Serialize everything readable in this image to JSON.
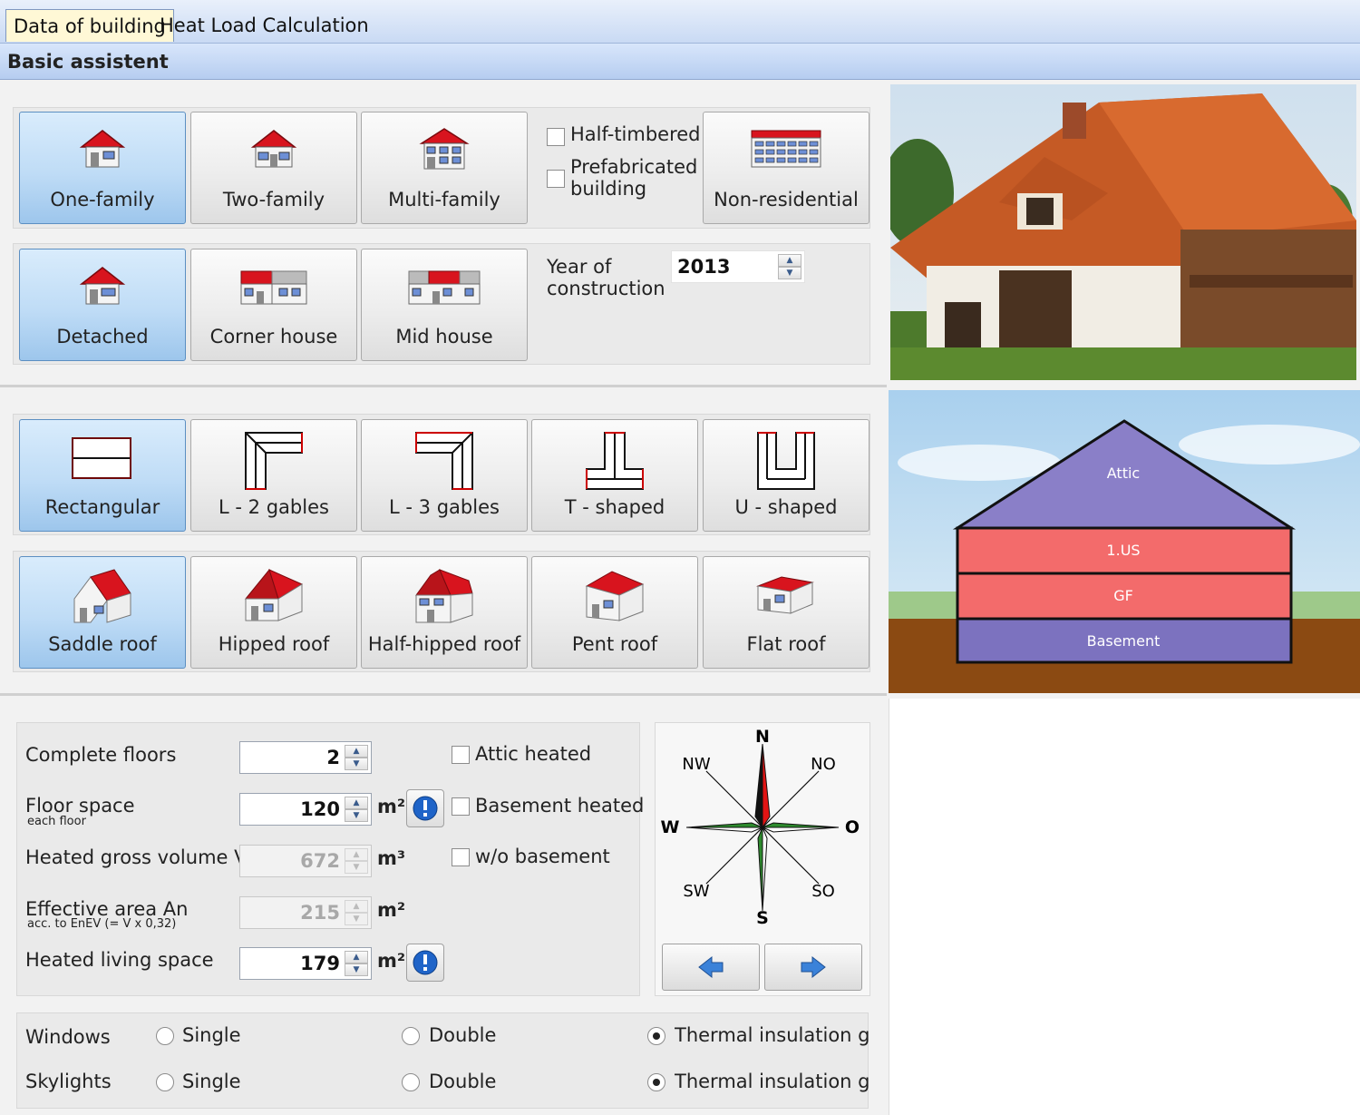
{
  "tabs": [
    {
      "label": "Data of building",
      "active": true
    },
    {
      "label": "Heat Load Calculation",
      "active": false
    }
  ],
  "header": {
    "title": "Basic assistent"
  },
  "building_type": {
    "options": [
      {
        "label": "One-family",
        "selected": true
      },
      {
        "label": "Two-family",
        "selected": false
      },
      {
        "label": "Multi-family",
        "selected": false
      },
      {
        "label": "Non-residential",
        "selected": false
      }
    ],
    "half_timbered": {
      "label": "Half-timbered",
      "checked": false
    },
    "prefabricated": {
      "label_line1": "Prefabricated",
      "label_line2": "building",
      "checked": false
    }
  },
  "house_position": {
    "options": [
      {
        "label": "Detached",
        "selected": true
      },
      {
        "label": "Corner house",
        "selected": false
      },
      {
        "label": "Mid house",
        "selected": false
      }
    ],
    "year": {
      "label_line1": "Year of",
      "label_line2": "construction",
      "value": "2013"
    }
  },
  "shape": {
    "options": [
      {
        "label": "Rectangular",
        "selected": true
      },
      {
        "label": "L - 2 gables",
        "selected": false
      },
      {
        "label": "L - 3 gables",
        "selected": false
      },
      {
        "label": "T - shaped",
        "selected": false
      },
      {
        "label": "U - shaped",
        "selected": false
      }
    ]
  },
  "roof": {
    "options": [
      {
        "label": "Saddle roof",
        "selected": true
      },
      {
        "label": "Hipped roof",
        "selected": false
      },
      {
        "label": "Half-hipped roof",
        "selected": false
      },
      {
        "label": "Pent roof",
        "selected": false
      },
      {
        "label": "Flat roof",
        "selected": false
      }
    ]
  },
  "dimensions": {
    "complete_floors": {
      "label": "Complete floors",
      "value": "2"
    },
    "floor_space": {
      "label": "Floor space",
      "sublabel": "each floor",
      "value": "120",
      "unit": "m²"
    },
    "gross_volume": {
      "label": "Heated gross volume V",
      "value": "672",
      "unit": "m³"
    },
    "effective_area": {
      "label": "Effective area An",
      "sublabel": "acc. to EnEV (= V x 0,32)",
      "value": "215",
      "unit": "m²"
    },
    "living_space": {
      "label": "Heated living space",
      "value": "179",
      "unit": "m²"
    },
    "attic_heated": {
      "label": "Attic heated",
      "checked": false
    },
    "basement_heated": {
      "label": "Basement heated",
      "checked": false
    },
    "wo_basement": {
      "label": "w/o basement",
      "checked": false
    }
  },
  "compass": {
    "n": "N",
    "s": "S",
    "w": "W",
    "o": "O",
    "nw": "NW",
    "no": "NO",
    "sw": "SW",
    "so": "SO"
  },
  "glazing": {
    "windows": {
      "label": "Windows",
      "single": "Single",
      "double": "Double",
      "thermal": "Thermal insulation glazir",
      "selected": "thermal"
    },
    "skylights": {
      "label": "Skylights",
      "single": "Single",
      "double": "Double",
      "thermal": "Thermal insulation glazir",
      "selected": "thermal"
    }
  },
  "floors_diagram": {
    "attic": "Attic",
    "us1": "1.US",
    "gf": "GF",
    "basement": "Basement"
  },
  "colors": {
    "selected_tile": "#bfdcf6",
    "attic": "#8a7fc8",
    "floor": "#f36b6b",
    "basement": "#7c72bf",
    "ground": "#8b4a12"
  }
}
